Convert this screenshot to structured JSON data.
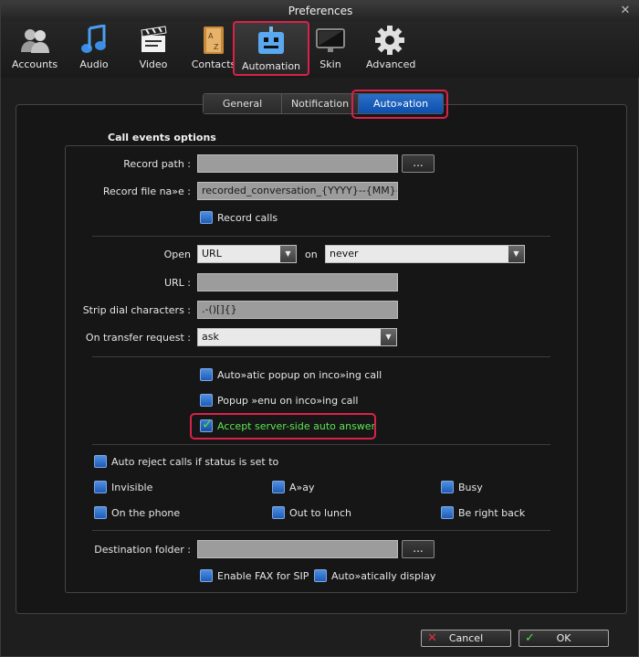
{
  "window": {
    "title": "Preferences",
    "close_glyph": "✕"
  },
  "toolbar": {
    "items": [
      {
        "label": "Accounts",
        "icon": "accounts-icon"
      },
      {
        "label": "Audio",
        "icon": "audio-icon"
      },
      {
        "label": "Video",
        "icon": "video-icon"
      },
      {
        "label": "Contacts",
        "icon": "contacts-icon"
      },
      {
        "label": "Automation",
        "icon": "automation-icon",
        "active": true
      },
      {
        "label": "Skin",
        "icon": "skin-icon"
      },
      {
        "label": "Advanced",
        "icon": "advanced-icon"
      }
    ]
  },
  "tabs": [
    {
      "label": "General"
    },
    {
      "label": "Notification"
    },
    {
      "label": "Auto»ation",
      "active": true
    }
  ],
  "section_title": "Call events options",
  "record": {
    "path_label": "Record path :",
    "path_value": "",
    "browse_label": "...",
    "filename_label": "Record file na»e :",
    "filename_value": "recorded_conversation_{YYYY}--{MM}--{DD}-",
    "record_calls_label": "Record calls",
    "record_calls_checked": false
  },
  "open": {
    "open_label": "Open",
    "open_value": "URL",
    "on_label": "on",
    "on_value": "never",
    "url_label": "URL :",
    "url_value": "",
    "strip_label": "Strip dial characters :",
    "strip_value": " .-()[]{}",
    "transfer_label": "On transfer request :",
    "transfer_value": "ask"
  },
  "popup": {
    "auto_popup_label": "Auto»atic popup on inco»ing call",
    "popup_menu_label": "Popup »enu on inco»ing call",
    "accept_auto_answer_label": "Accept server-side auto answer",
    "accept_auto_answer_checked": true
  },
  "reject": {
    "auto_reject_label": "Auto reject calls if status is set to",
    "statuses": [
      "Invisible",
      "A»ay",
      "Busy",
      "On the phone",
      "Out to lunch",
      "Be right back"
    ]
  },
  "fax": {
    "destination_label": "Destination folder :",
    "destination_value": "",
    "browse_label": "...",
    "enable_fax_label": "Enable FAX for SIP",
    "auto_display_label": "Auto»atically display"
  },
  "footer": {
    "cancel_label": "Cancel",
    "ok_label": "OK"
  },
  "colors": {
    "accent": "#0d4fae",
    "highlight": "#d9224a",
    "check_green": "#59e84f"
  }
}
